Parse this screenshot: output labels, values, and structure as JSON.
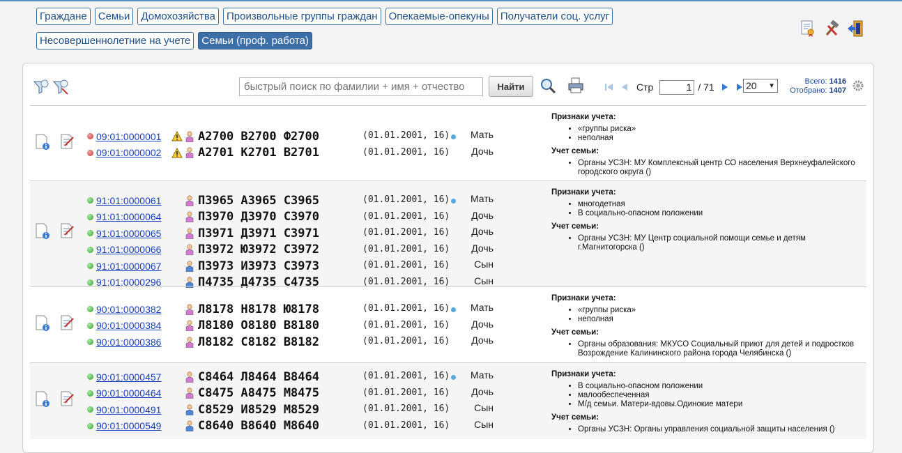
{
  "tabs": {
    "row1": [
      "Граждане",
      "Семьи",
      "Домохозяйства",
      "Произвольные группы граждан",
      "Опекаемые-опекуны",
      "Получатели соц. услуг"
    ],
    "row2": [
      "Несовершеннолетние на учете",
      "Семьи (проф. работа)"
    ],
    "active": "Семьи (проф. работа)"
  },
  "toolbar": {
    "search_placeholder": "быстрый поиск по фамилии + имя + отчество",
    "search_button": "Найти",
    "page_label": "Стр",
    "page_current": "1",
    "page_total": "/ 71",
    "page_size": "20",
    "total_label": "Всего:",
    "total_value": "1416",
    "selected_label": "Отобрано:",
    "selected_value": "1407"
  },
  "families": [
    {
      "members": [
        {
          "id": "09:01:0000001",
          "status": "red",
          "warn": true,
          "gender": "f",
          "name": "А2700 В2700 Ф2700",
          "date": "(01.01.2001, 16)",
          "role": "Мать",
          "head": true
        },
        {
          "id": "09:01:0000002",
          "status": "red",
          "warn": true,
          "gender": "f",
          "name": "А2701 К2701 В2701",
          "date": "(01.01.2001, 16)",
          "role": "Дочь",
          "head": false
        }
      ],
      "signs_title": "Признаки учета:",
      "signs": [
        "«группы риска»",
        "неполная"
      ],
      "reg_title": "Учет семьи:",
      "reg": [
        "Органы УСЗН: МУ Комплексный центр СО населения Верхнеуфалейского городского округа ()"
      ]
    },
    {
      "members": [
        {
          "id": "91:01:0000061",
          "status": "green",
          "warn": false,
          "gender": "f",
          "name": "П3965 А3965 С3965",
          "date": "(01.01.2001, 16)",
          "role": "Мать",
          "head": true
        },
        {
          "id": "91:01:0000064",
          "status": "green",
          "warn": false,
          "gender": "f",
          "name": "П3970 Д3970 С3970",
          "date": "(01.01.2001, 16)",
          "role": "Дочь",
          "head": false
        },
        {
          "id": "91:01:0000065",
          "status": "green",
          "warn": false,
          "gender": "f",
          "name": "П3971 Д3971 С3971",
          "date": "(01.01.2001, 16)",
          "role": "Дочь",
          "head": false
        },
        {
          "id": "91:01:0000066",
          "status": "green",
          "warn": false,
          "gender": "f",
          "name": "П3972 Ю3972 С3972",
          "date": "(01.01.2001, 16)",
          "role": "Дочь",
          "head": false
        },
        {
          "id": "91:01:0000067",
          "status": "green",
          "warn": false,
          "gender": "m",
          "name": "П3973 И3973 С3973",
          "date": "(01.01.2001, 16)",
          "role": "Сын",
          "head": false
        },
        {
          "id": "91:01:0000296",
          "status": "green",
          "warn": false,
          "gender": "m",
          "name": "П4735 Д4735 С4735",
          "date": "(01.01.2001, 16)",
          "role": "Сын",
          "head": false
        }
      ],
      "signs_title": "Признаки учета:",
      "signs": [
        "многодетная",
        "В социально-опасном положении"
      ],
      "reg_title": "Учет семьи:",
      "reg": [
        "Органы УСЗН: МУ Центр социальной помощи семье и детям г.Магнитогорска ()"
      ]
    },
    {
      "members": [
        {
          "id": "90:01:0000382",
          "status": "green",
          "warn": false,
          "gender": "f",
          "name": "Л8178 Н8178 Ю8178",
          "date": "(01.01.2001, 16)",
          "role": "Мать",
          "head": true
        },
        {
          "id": "90:01:0000384",
          "status": "green",
          "warn": false,
          "gender": "f",
          "name": "Л8180 О8180 В8180",
          "date": "(01.01.2001, 16)",
          "role": "Дочь",
          "head": false
        },
        {
          "id": "90:01:0000386",
          "status": "green",
          "warn": false,
          "gender": "f",
          "name": "Л8182 С8182 В8182",
          "date": "(01.01.2001, 16)",
          "role": "Дочь",
          "head": false
        }
      ],
      "signs_title": "Признаки учета:",
      "signs": [
        "«группы риска»",
        "неполная"
      ],
      "reg_title": "Учет семьи:",
      "reg": [
        "Органы образования: МКУСО Социальный приют для детей и подростков Возрождение Калининского района города Челябинска ()"
      ]
    },
    {
      "members": [
        {
          "id": "90:01:0000457",
          "status": "green",
          "warn": false,
          "gender": "f",
          "name": "С8464 Л8464 В8464",
          "date": "(01.01.2001, 16)",
          "role": "Мать",
          "head": true
        },
        {
          "id": "90:01:0000464",
          "status": "green",
          "warn": false,
          "gender": "f",
          "name": "С8475 А8475 М8475",
          "date": "(01.01.2001, 16)",
          "role": "Дочь",
          "head": false
        },
        {
          "id": "90:01:0000491",
          "status": "green",
          "warn": false,
          "gender": "m",
          "name": "С8529 И8529 М8529",
          "date": "(01.01.2001, 16)",
          "role": "Сын",
          "head": false
        },
        {
          "id": "90:01:0000549",
          "status": "green",
          "warn": false,
          "gender": "m",
          "name": "С8640 В8640 М8640",
          "date": "(01.01.2001, 16)",
          "role": "Сын",
          "head": false
        }
      ],
      "signs_title": "Признаки учета:",
      "signs": [
        "В социально-опасном положении",
        "малообеспеченная",
        "М/д семьи. Матери-вдовы.Одинокие матери"
      ],
      "reg_title": "Учет семьи:",
      "reg": [
        "Органы УСЗН: Органы управления социальной защиты населения ()"
      ]
    }
  ]
}
